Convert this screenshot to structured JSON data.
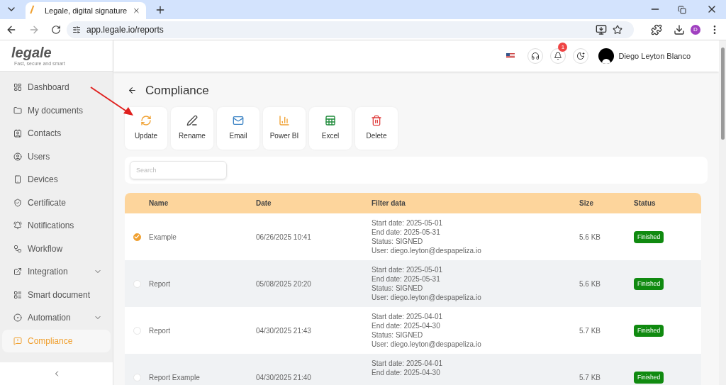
{
  "browser": {
    "tab_title": "Legale, digital signature",
    "url": "app.legale.io/reports",
    "profile_initial": "D"
  },
  "sidebar": {
    "logo": "legale",
    "tagline": "Fast, secure and smart",
    "items": [
      {
        "label": "Dashboard",
        "selected": false,
        "expandable": false
      },
      {
        "label": "My documents",
        "selected": false,
        "expandable": false
      },
      {
        "label": "Contacts",
        "selected": false,
        "expandable": false
      },
      {
        "label": "Users",
        "selected": false,
        "expandable": false
      },
      {
        "label": "Devices",
        "selected": false,
        "expandable": false
      },
      {
        "label": "Certificate",
        "selected": false,
        "expandable": false
      },
      {
        "label": "Notifications",
        "selected": false,
        "expandable": false
      },
      {
        "label": "Workflow",
        "selected": false,
        "expandable": false
      },
      {
        "label": "Integration",
        "selected": false,
        "expandable": true
      },
      {
        "label": "Smart document",
        "selected": false,
        "expandable": false
      },
      {
        "label": "Automation",
        "selected": false,
        "expandable": true
      },
      {
        "label": "Compliance",
        "selected": true,
        "expandable": false
      }
    ]
  },
  "header": {
    "notification_count": "1",
    "user_name": "Diego Leyton Blanco"
  },
  "page": {
    "title": "Compliance",
    "actions": [
      "Update",
      "Rename",
      "Email",
      "Power BI",
      "Excel",
      "Delete"
    ],
    "search": {
      "placeholder": "Search"
    }
  },
  "table": {
    "columns": [
      "Name",
      "Date",
      "Filter data",
      "Size",
      "Status"
    ],
    "rows": [
      {
        "checked": true,
        "name": "Example",
        "date": "06/26/2025 10:41",
        "filter": [
          "Start date: 2025-05-01",
          "End date: 2025-05-31",
          "Status: SIGNED",
          "User: diego.leyton@despapeliza.io"
        ],
        "size": "5.6 KB",
        "status": "Finished"
      },
      {
        "checked": false,
        "name": "Report",
        "date": "05/08/2025 20:20",
        "filter": [
          "Start date: 2025-05-01",
          "End date: 2025-05-31",
          "Status: SIGNED",
          "User: diego.leyton@despapeliza.io"
        ],
        "size": "5.6 KB",
        "status": "Finished"
      },
      {
        "checked": false,
        "name": "Report",
        "date": "04/30/2025 21:43",
        "filter": [
          "Start date: 2025-04-01",
          "End date: 2025-04-30",
          "Status: SIGNED",
          "User: diego.leyton@despapeliza.io"
        ],
        "size": "5.7 KB",
        "status": "Finished"
      },
      {
        "checked": false,
        "name": "Report Example",
        "date": "04/30/2025 21:40",
        "filter": [
          "Start date: 2025-04-01",
          "End date: 2025-04-30"
        ],
        "size": "5.7 KB",
        "status": "Finished"
      }
    ]
  }
}
